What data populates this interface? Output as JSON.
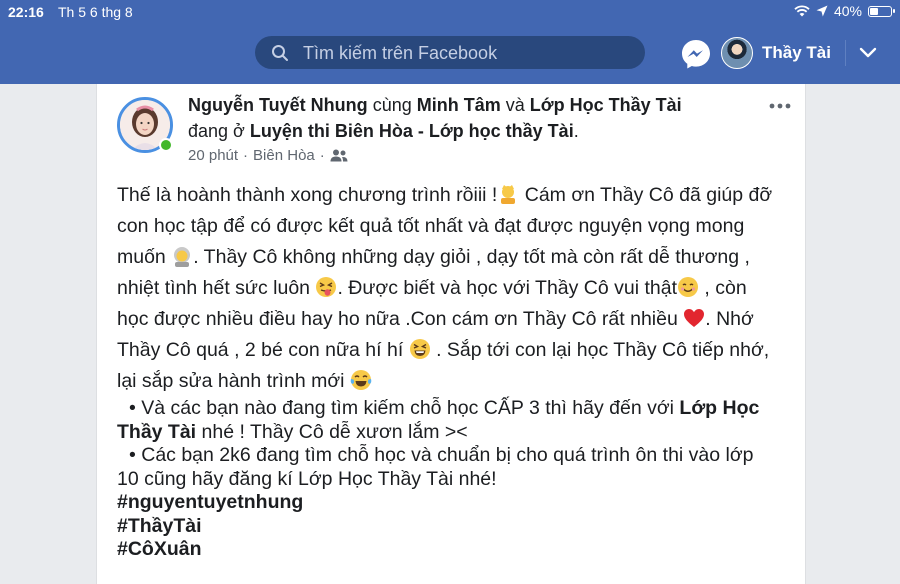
{
  "statusbar": {
    "time": "22:16",
    "date": "Th 5 6 thg 8",
    "battery": "40%",
    "battery_level": 0.4
  },
  "header": {
    "search_placeholder": "Tìm kiếm trên Facebook",
    "profile_name": "Thầy Tài",
    "brand_color": "#4267b2"
  },
  "post": {
    "author": "Nguyễn Tuyết Nhung",
    "with_word": "cùng",
    "tagged_1": "Minh Tâm",
    "and_word": "và",
    "tagged_2": "Lớp Học Thầy Tài",
    "at_word": "đang ở",
    "place": "Luyện thi Biên Hòa - Lớp học thầy Tài",
    "period": ".",
    "time": "20 phút",
    "sep": "·",
    "location": "Biên Hòa",
    "sep2": "·",
    "line1": "Thế là hoành thành xong chương trình rồiii !",
    "line1b": " Cám ơn Thầy Cô đã giúp đỡ",
    "line2": "con học tập để có được kết quả tốt nhất và đạt được nguyện vọng mong",
    "line3a": "muốn",
    "line3b": ". Thầy Cô không những dạy giỏi , dạy tốt mà còn rất dễ thương ,",
    "line4a": "nhiệt tình hết sức luôn",
    "line4b": ". Được biết và học với Thầy Cô vui thật",
    "line4c": " , còn",
    "line5a": "học được nhiều điều hay ho nữa .Con cám ơn Thầy Cô rất nhiều",
    "line5b": ". Nhớ",
    "line6a": "Thầy Cô quá , 2 bé con nữa hí hí",
    "line6b": " . Sắp tới con lại học Thầy Cô tiếp nhớ,",
    "line7": "lại sắp sửa hành trình mới",
    "bullet1a": "• Và các bạn nào đang tìm kiếm chỗ học CẤP 3 thì hãy đến với",
    "bullet1_bold": "Lớp Học",
    "bullet1_bold2": "Thầy Tài",
    "bullet1b": " nhé ! Thầy Cô dễ xươn lắm ><",
    "bullet2a": "• Các bạn 2k6 đang tìm chỗ học và chuẩn bị cho quá trình ôn thi vào lớp",
    "bullet2b": "10 cũng hãy đăng kí Lớp Học Thầy Tài nhé!",
    "hashtags": [
      "#nguyentuyetnhung",
      "#ThầyTài",
      "#CôXuân"
    ]
  }
}
